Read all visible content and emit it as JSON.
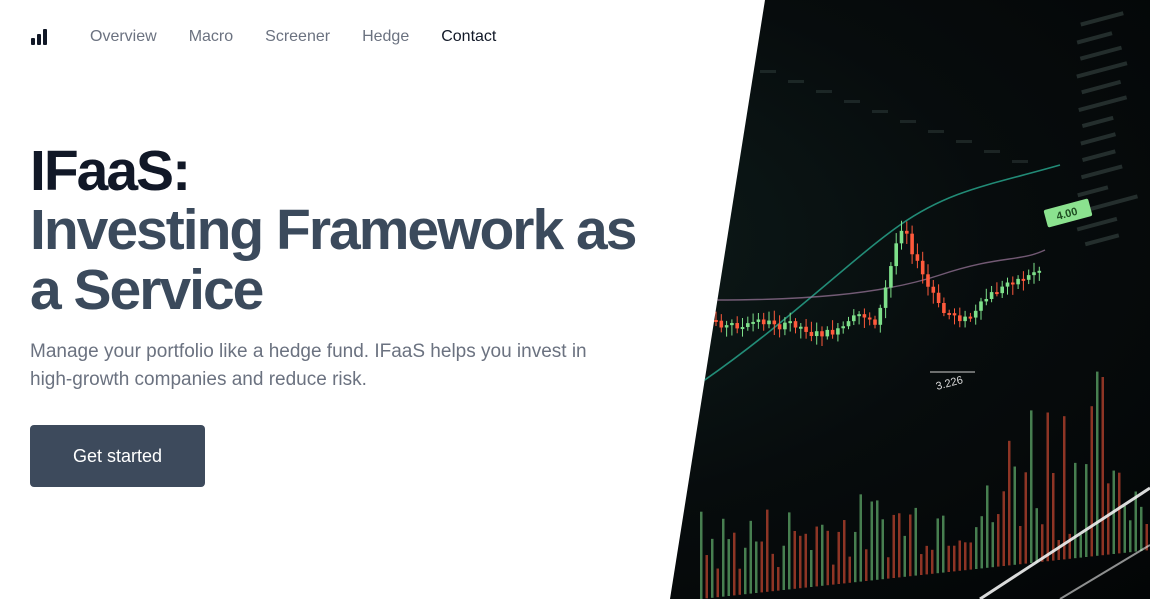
{
  "nav": {
    "logo_icon": "bar-chart-icon",
    "items": [
      {
        "label": "Overview",
        "active": false
      },
      {
        "label": "Macro",
        "active": false
      },
      {
        "label": "Screener",
        "active": false
      },
      {
        "label": "Hedge",
        "active": false
      },
      {
        "label": "Contact",
        "active": true
      }
    ]
  },
  "hero": {
    "title_line1": "IFaaS:",
    "title_line2": "Investing Framework as a Service",
    "subtitle": "Manage your portfolio like a hedge fund. IFaaS helps you invest in high-growth companies and reduce risk.",
    "cta_label": "Get started",
    "image": {
      "description": "candlestick-chart-photo",
      "price_label": "3.226",
      "badge_label": "4.00"
    }
  },
  "colors": {
    "title_dark": "#111827",
    "title_slate": "#3b4a5c",
    "button_bg": "#3d4a5c",
    "candle_up": "#7ee08a",
    "candle_down": "#ff5a3c"
  }
}
